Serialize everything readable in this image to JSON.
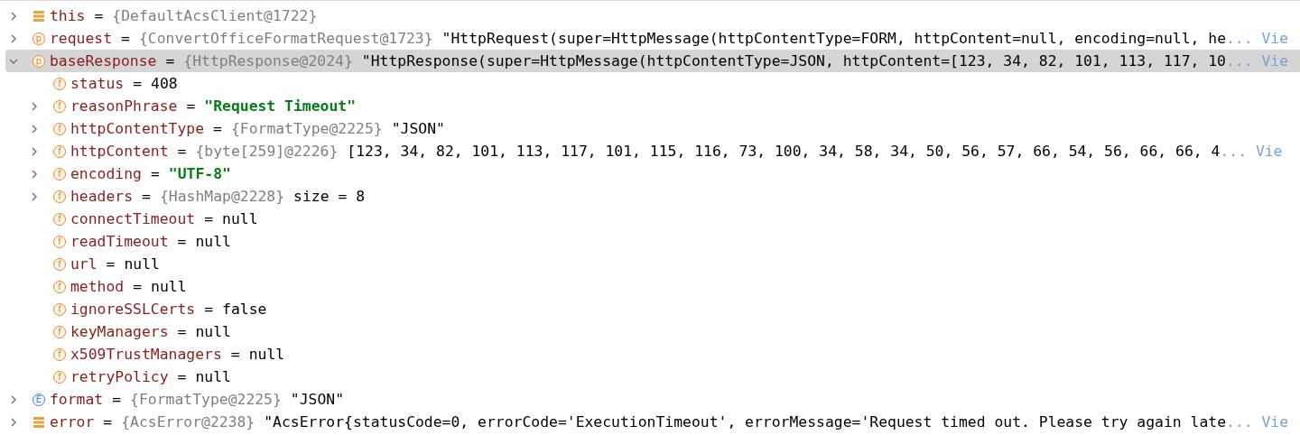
{
  "variables": [
    {
      "name": "this",
      "op": "=",
      "kind": "object",
      "type": "{DefaultAcsClient@1722}",
      "expandable": true,
      "expanded": false,
      "selected": false
    },
    {
      "name": "request",
      "op": "=",
      "kind": "field",
      "badge": "p",
      "type": "{ConvertOfficeFormatRequest@1723}",
      "value": "\"HttpRequest(super=HttpMessage(httpContentType=FORM, httpContent=null, encoding=null, he",
      "string_literal": false,
      "more": "... Vie",
      "expandable": true,
      "expanded": false,
      "selected": false
    },
    {
      "name": "baseResponse",
      "op": "=",
      "kind": "field",
      "badge": "p",
      "type": "{HttpResponse@2024}",
      "value": "\"HttpResponse(super=HttpMessage(httpContentType=JSON, httpContent=[123, 34, 82, 101, 113, 117, 10",
      "string_literal": false,
      "more": "... Vie",
      "expandable": true,
      "expanded": true,
      "selected": true,
      "children": [
        {
          "name": "status",
          "op": "=",
          "kind": "field",
          "badge": "f",
          "value": "408",
          "string_literal": false,
          "expandable": false,
          "selected": false
        },
        {
          "name": "reasonPhrase",
          "op": "=",
          "kind": "field",
          "badge": "f",
          "value": "\"Request Timeout\"",
          "string_literal": true,
          "expandable": true,
          "expanded": false,
          "selected": false
        },
        {
          "name": "httpContentType",
          "op": "=",
          "kind": "field",
          "badge": "f",
          "type": "{FormatType@2225}",
          "value": "\"JSON\"",
          "string_literal": false,
          "expandable": true,
          "expanded": false,
          "selected": false
        },
        {
          "name": "httpContent",
          "op": "=",
          "kind": "field",
          "badge": "f",
          "type": "{byte[259]@2226}",
          "value": "[123, 34, 82, 101, 113, 117, 101, 115, 116, 73, 100, 34, 58, 34, 50, 56, 57, 66, 54, 56, 66, 66, 4",
          "string_literal": false,
          "more": "... Vie",
          "expandable": true,
          "expanded": false,
          "selected": false
        },
        {
          "name": "encoding",
          "op": "=",
          "kind": "field",
          "badge": "f",
          "value": "\"UTF-8\"",
          "string_literal": true,
          "expandable": true,
          "expanded": false,
          "selected": false
        },
        {
          "name": "headers",
          "op": "=",
          "kind": "field",
          "badge": "f",
          "type": "{HashMap@2228}",
          "value": "size = 8",
          "string_literal": false,
          "expandable": true,
          "expanded": false,
          "selected": false
        },
        {
          "name": "connectTimeout",
          "op": "=",
          "kind": "field",
          "badge": "f",
          "value": "null",
          "string_literal": false,
          "expandable": false,
          "selected": false
        },
        {
          "name": "readTimeout",
          "op": "=",
          "kind": "field",
          "badge": "f",
          "value": "null",
          "string_literal": false,
          "expandable": false,
          "selected": false
        },
        {
          "name": "url",
          "op": "=",
          "kind": "field",
          "badge": "f",
          "value": "null",
          "string_literal": false,
          "expandable": false,
          "selected": false
        },
        {
          "name": "method",
          "op": "=",
          "kind": "field",
          "badge": "f",
          "value": "null",
          "string_literal": false,
          "expandable": false,
          "selected": false
        },
        {
          "name": "ignoreSSLCerts",
          "op": "=",
          "kind": "field",
          "badge": "f",
          "value": "false",
          "string_literal": false,
          "expandable": false,
          "selected": false
        },
        {
          "name": "keyManagers",
          "op": "=",
          "kind": "field",
          "badge": "f",
          "value": "null",
          "string_literal": false,
          "expandable": false,
          "selected": false
        },
        {
          "name": "x509TrustManagers",
          "op": "=",
          "kind": "field",
          "badge": "f",
          "value": "null",
          "string_literal": false,
          "expandable": false,
          "selected": false
        },
        {
          "name": "retryPolicy",
          "op": "=",
          "kind": "field",
          "badge": "f",
          "value": "null",
          "string_literal": false,
          "expandable": false,
          "selected": false
        }
      ]
    },
    {
      "name": "format",
      "op": "=",
      "kind": "enum",
      "badge": "E",
      "type": "{FormatType@2225}",
      "value": "\"JSON\"",
      "string_literal": false,
      "expandable": true,
      "expanded": false,
      "selected": false
    },
    {
      "name": "error",
      "op": "=",
      "kind": "object",
      "type": "{AcsError@2238}",
      "value": "\"AcsError{statusCode=0, errorCode='ExecutionTimeout', errorMessage='Request timed out. Please try again late",
      "string_literal": false,
      "more": "... Vie",
      "expandable": true,
      "expanded": false,
      "selected": false
    }
  ]
}
